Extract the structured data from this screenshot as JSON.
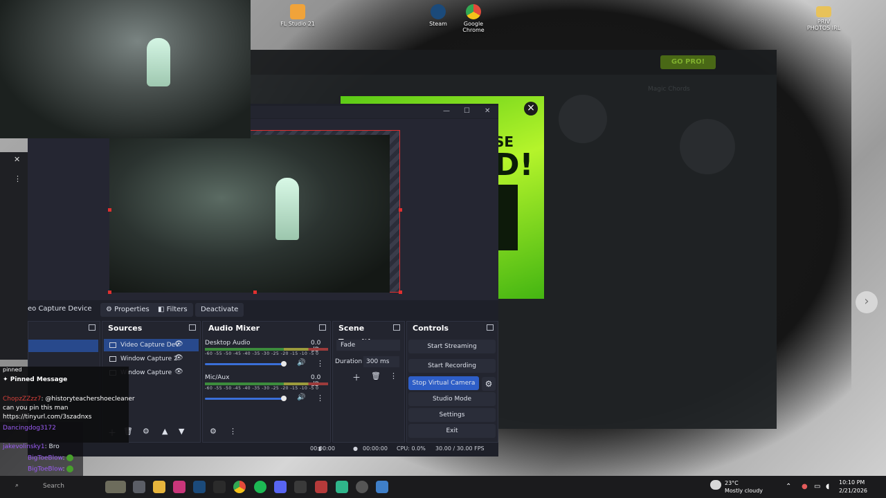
{
  "desktop": {
    "icons": [
      {
        "label": "FL Studio 21",
        "icon": "fl-studio-icon",
        "color": "#f0a33a"
      },
      {
        "label": "Steam",
        "icon": "steam-icon",
        "color": "#1b4a7a"
      },
      {
        "label": "Google Chrome",
        "icon": "chrome-icon",
        "color": "#e34a3a"
      },
      {
        "label": "PRIV PHOTOS IRL",
        "icon": "folder-icon",
        "color": "#e8c25a"
      }
    ]
  },
  "back_app": {
    "gopro": "GO PRO!",
    "title": "Magic Chords"
  },
  "ad": {
    "text_top": "SE",
    "text_mid": "D!"
  },
  "obs": {
    "toolbar": {
      "source_name": "eo Capture Device",
      "properties": "Properties",
      "filters": "Filters",
      "deactivate": "Deactivate"
    },
    "sources": {
      "title": "Sources",
      "items": [
        {
          "label": "Video Capture Dev",
          "selected": true
        },
        {
          "label": "Window Capture 2",
          "selected": false
        },
        {
          "label": "Window Capture",
          "selected": false
        }
      ]
    },
    "mixer": {
      "title": "Audio Mixer",
      "scale": "-60 -55 -50 -45 -40 -35 -30 -25 -20 -15 -10 -5 0",
      "channels": [
        {
          "name": "Desktop Audio",
          "db": "0.0 dB",
          "volume": 0.88
        },
        {
          "name": "Mic/Aux",
          "db": "0.0 dB",
          "volume": 0.88
        }
      ]
    },
    "transitions": {
      "title": "Scene Transiti...",
      "type": "Fade",
      "duration_label": "Duration",
      "duration_value": "300 ms"
    },
    "controls": {
      "title": "Controls",
      "start_streaming": "Start Streaming",
      "start_recording": "Start Recording",
      "stop_virtual_camera": "Stop Virtual Camera",
      "studio_mode": "Studio Mode",
      "settings": "Settings",
      "exit": "Exit"
    },
    "status": {
      "stream_time": "00:00:00",
      "rec_time": "00:00:00",
      "cpu": "CPU: 0.0%",
      "fps": "30.00 / 30.00 FPS"
    }
  },
  "chat": {
    "pinned_header": "pinned",
    "pinned_title": "Pinned Message",
    "pinned_user": "ChopzZZzz7",
    "pinned_text": ": @historyteachershoecleaner",
    "line2": "can you pin this man",
    "line3": "https://tinyurl.com/3szadnxs",
    "messages": [
      {
        "user": "Dancingdog3172",
        "text": ""
      },
      {
        "user": "jakevolinsky1",
        "text": ": Bro"
      },
      {
        "user": "BigToeBlow",
        "text": ":"
      },
      {
        "user": "BigToeBlow",
        "text": ":"
      },
      {
        "user": "BigToeBlow",
        "text": ":"
      },
      {
        "user": "BigToeBlow",
        "text": ":"
      }
    ]
  },
  "taskbar": {
    "search": "Search",
    "weather_temp": "23°C",
    "weather_text": "Mostly cloudy",
    "time": "10:10 PM",
    "date": "2/21/2026",
    "apps": [
      "explorer-icon",
      "files-icon",
      "instagram-icon",
      "steam-icon",
      "epic-icon",
      "chrome-icon",
      "spotify-icon",
      "discord-icon",
      "obs-icon",
      "voicemeeter-icon",
      "app-icon",
      "settings-icon",
      "shield-icon"
    ]
  }
}
